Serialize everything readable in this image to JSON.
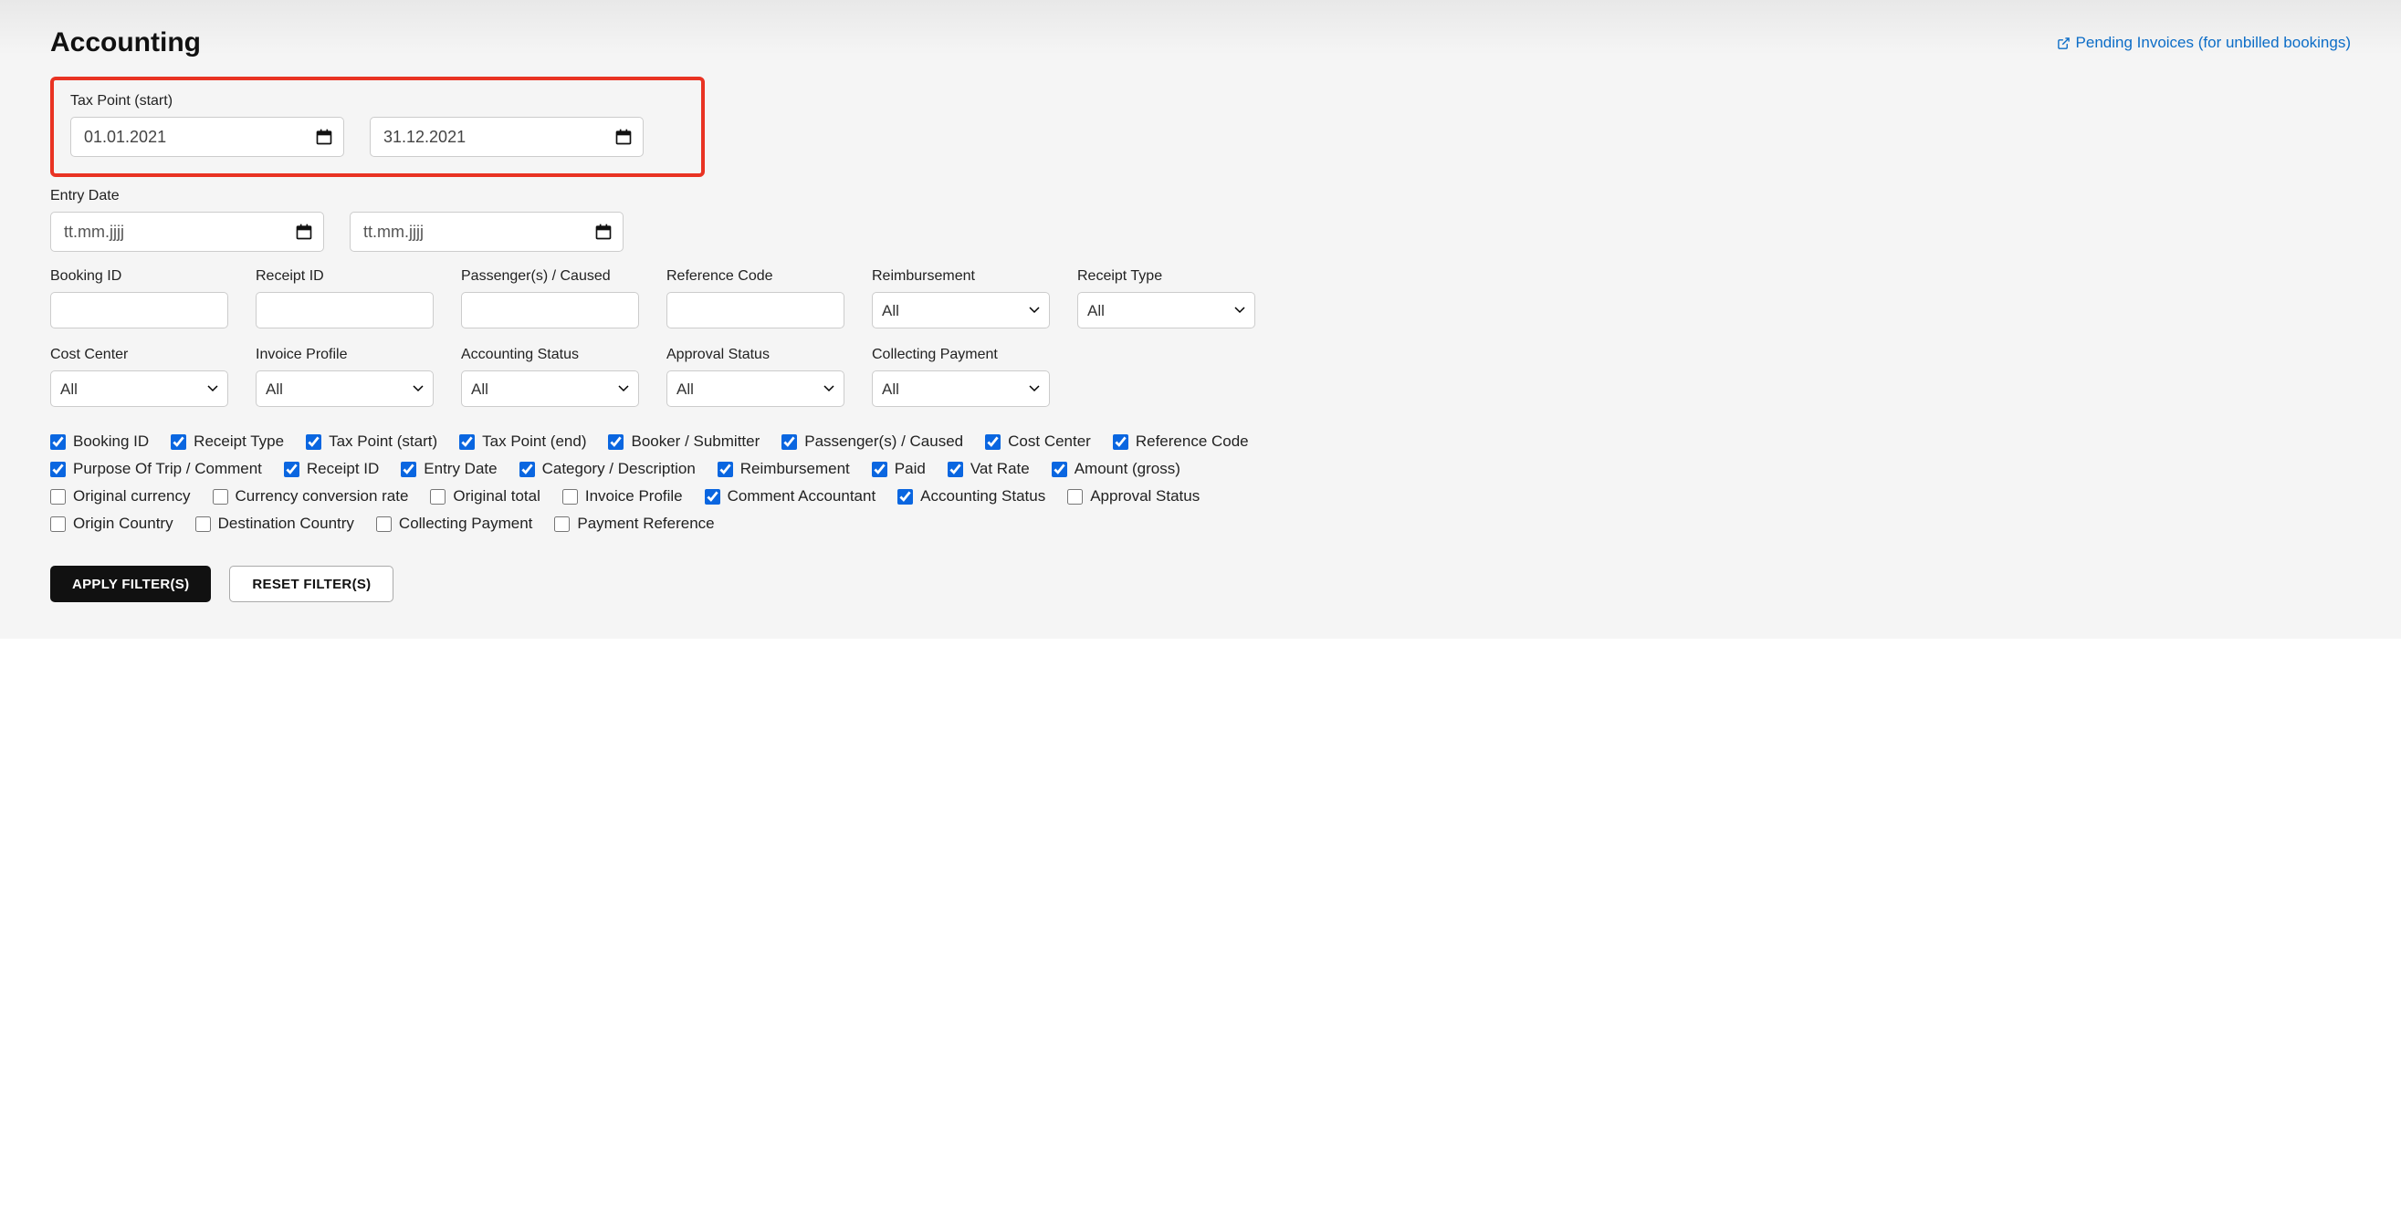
{
  "header": {
    "title": "Accounting",
    "pending_link": "Pending Invoices (for unbilled bookings)"
  },
  "tax_point": {
    "label": "Tax Point (start)",
    "start_value": "01.01.2021",
    "end_value": "31.12.2021"
  },
  "entry_date": {
    "label": "Entry Date",
    "start_placeholder": "tt.mm.jjjj",
    "end_placeholder": "tt.mm.jjjj"
  },
  "filters": {
    "booking_id": {
      "label": "Booking ID",
      "value": ""
    },
    "receipt_id": {
      "label": "Receipt ID",
      "value": ""
    },
    "passengers": {
      "label": "Passenger(s) / Caused",
      "value": ""
    },
    "reference_code": {
      "label": "Reference Code",
      "value": ""
    },
    "reimbursement": {
      "label": "Reimbursement",
      "value": "All"
    },
    "receipt_type": {
      "label": "Receipt Type",
      "value": "All"
    },
    "cost_center": {
      "label": "Cost Center",
      "value": "All"
    },
    "invoice_profile": {
      "label": "Invoice Profile",
      "value": "All"
    },
    "accounting_status": {
      "label": "Accounting Status",
      "value": "All"
    },
    "approval_status": {
      "label": "Approval Status",
      "value": "All"
    },
    "collecting_payment": {
      "label": "Collecting Payment",
      "value": "All"
    }
  },
  "columns": [
    {
      "label": "Booking ID",
      "checked": true
    },
    {
      "label": "Receipt Type",
      "checked": true
    },
    {
      "label": "Tax Point (start)",
      "checked": true
    },
    {
      "label": "Tax Point (end)",
      "checked": true
    },
    {
      "label": "Booker / Submitter",
      "checked": true
    },
    {
      "label": "Passenger(s) / Caused",
      "checked": true
    },
    {
      "label": "Cost Center",
      "checked": true
    },
    {
      "label": "Reference Code",
      "checked": true
    },
    {
      "label": "Purpose Of Trip / Comment",
      "checked": true
    },
    {
      "label": "Receipt ID",
      "checked": true
    },
    {
      "label": "Entry Date",
      "checked": true
    },
    {
      "label": "Category / Description",
      "checked": true
    },
    {
      "label": "Reimbursement",
      "checked": true
    },
    {
      "label": "Paid",
      "checked": true
    },
    {
      "label": "Vat Rate",
      "checked": true
    },
    {
      "label": "Amount (gross)",
      "checked": true
    },
    {
      "label": "Original currency",
      "checked": false
    },
    {
      "label": "Currency conversion rate",
      "checked": false
    },
    {
      "label": "Original total",
      "checked": false
    },
    {
      "label": "Invoice Profile",
      "checked": false
    },
    {
      "label": "Comment Accountant",
      "checked": true
    },
    {
      "label": "Accounting Status",
      "checked": true
    },
    {
      "label": "Approval Status",
      "checked": false
    },
    {
      "label": "Origin Country",
      "checked": false
    },
    {
      "label": "Destination Country",
      "checked": false
    },
    {
      "label": "Collecting Payment",
      "checked": false
    },
    {
      "label": "Payment Reference",
      "checked": false
    }
  ],
  "buttons": {
    "apply": "APPLY FILTER(S)",
    "reset": "RESET FILTER(S)"
  }
}
